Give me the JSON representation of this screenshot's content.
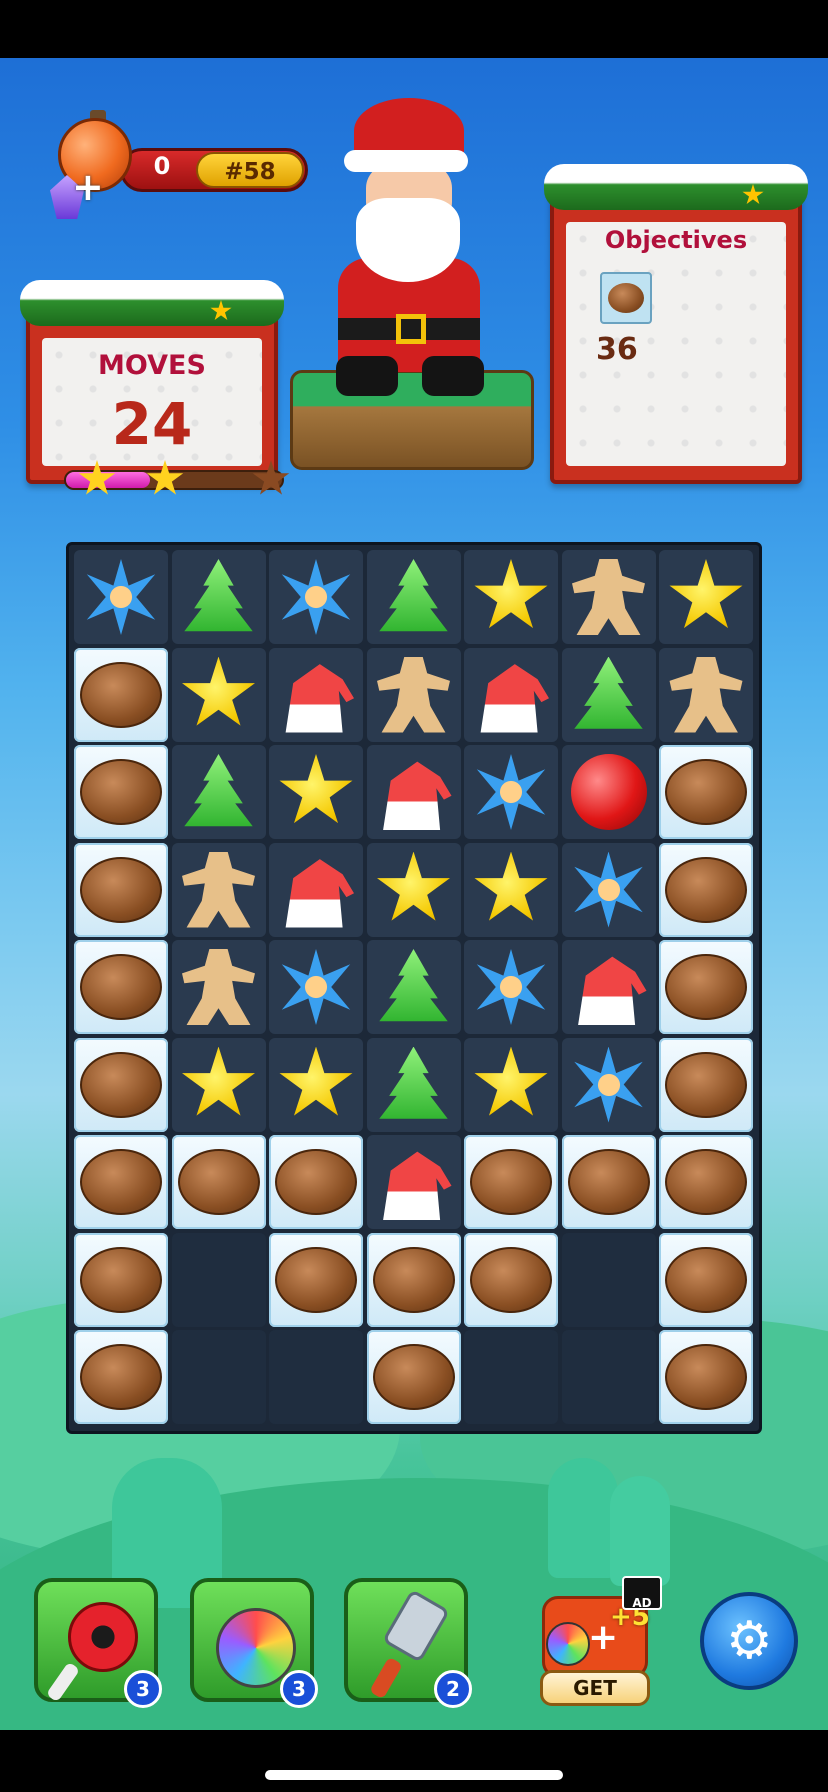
{
  "hud": {
    "booster_count": "0",
    "level": "#58"
  },
  "moves": {
    "label": "MOVES",
    "value": "24",
    "progress_fraction": 0.39,
    "stars_earned": 2
  },
  "objectives": {
    "label": "Objectives",
    "target_icon": "walnut-icon",
    "remaining": "36"
  },
  "board": {
    "rows": 9,
    "cols": 7,
    "grid": [
      [
        "snowflake",
        "tree",
        "snowflake",
        "tree",
        "star",
        "gingerbread",
        "star"
      ],
      [
        "walnut",
        "star",
        "hat",
        "gingerbread",
        "hat",
        "tree",
        "gingerbread"
      ],
      [
        "walnut",
        "tree",
        "star",
        "hat",
        "snowflake",
        "bomb",
        "walnut"
      ],
      [
        "walnut",
        "gingerbread",
        "hat",
        "star",
        "star",
        "snowflake",
        "walnut"
      ],
      [
        "walnut",
        "gingerbread",
        "snowflake",
        "tree",
        "snowflake",
        "hat",
        "walnut"
      ],
      [
        "walnut",
        "star",
        "star",
        "tree",
        "star",
        "snowflake",
        "walnut"
      ],
      [
        "walnut",
        "walnut",
        "walnut",
        "hat",
        "walnut",
        "walnut",
        "walnut"
      ],
      [
        "walnut",
        "empty",
        "walnut",
        "walnut",
        "walnut",
        "empty",
        "walnut"
      ],
      [
        "walnut",
        "empty",
        "empty",
        "walnut",
        "empty",
        "empty",
        "walnut"
      ]
    ]
  },
  "boosters": [
    {
      "name": "lollipop-hammer",
      "count": "3"
    },
    {
      "name": "rainbow-ornament",
      "count": "3"
    },
    {
      "name": "spatula",
      "count": "2"
    }
  ],
  "offer": {
    "bonus": "+5",
    "ad_label": "AD",
    "button": "GET"
  },
  "colors": {
    "frame_red": "#c9301f",
    "label_red": "#b1103b",
    "board_bg": "#1c2838",
    "booster_green": "#2f9c2a",
    "settings_blue": "#1f7ae0"
  }
}
